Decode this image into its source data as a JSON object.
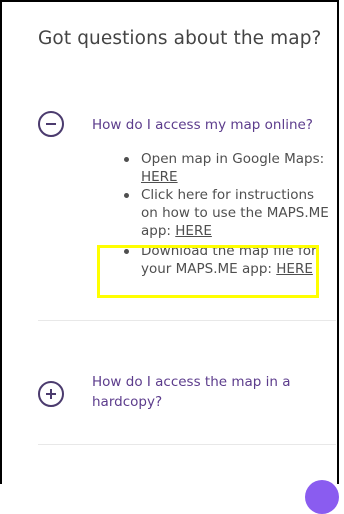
{
  "faq": {
    "heading": "Got questions about the map?",
    "items": [
      {
        "question": "How do I access my map online?",
        "expanded": true,
        "toggle_icon": "minus-circle-icon",
        "answers": [
          {
            "text": "Open map in Google Maps: ",
            "link": "HERE"
          },
          {
            "text": "Click here for instructions on how to use the MAPS.ME app: ",
            "link": "HERE"
          },
          {
            "text": "Download the map file for your MAPS.ME app: ",
            "link": "HERE"
          }
        ]
      },
      {
        "question": "How do I access the map in a hardcopy?",
        "expanded": false,
        "toggle_icon": "plus-circle-icon"
      }
    ]
  },
  "colors": {
    "accent": "#5c3c8c",
    "highlight": "#ffff00",
    "fab": "#8a5cf0"
  }
}
